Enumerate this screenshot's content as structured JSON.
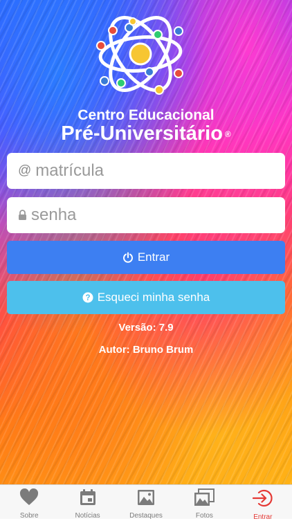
{
  "brand": {
    "line1": "Centro Educacional",
    "line2": "Pré-Universitário",
    "registered": "®"
  },
  "login": {
    "user_icon": "@",
    "user_placeholder": "matrícula",
    "pass_placeholder": "senha",
    "login_button": "Entrar",
    "forgot_button": "Esqueci minha senha"
  },
  "info": {
    "version": "Versão: 7.9",
    "author": "Autor: Bruno Brum"
  },
  "tabs": [
    {
      "label": "Sobre",
      "icon": "heart-icon"
    },
    {
      "label": "Notícias",
      "icon": "calendar-icon"
    },
    {
      "label": "Destaques",
      "icon": "image-icon"
    },
    {
      "label": "Fotos",
      "icon": "photos-icon"
    },
    {
      "label": "Entrar",
      "icon": "login-icon",
      "active": true
    }
  ],
  "colors": {
    "login_button": "#3d7ff2",
    "forgot_button": "#4dc0ec",
    "active_tab": "#e53935",
    "inactive_tab": "#7b7b7b"
  }
}
